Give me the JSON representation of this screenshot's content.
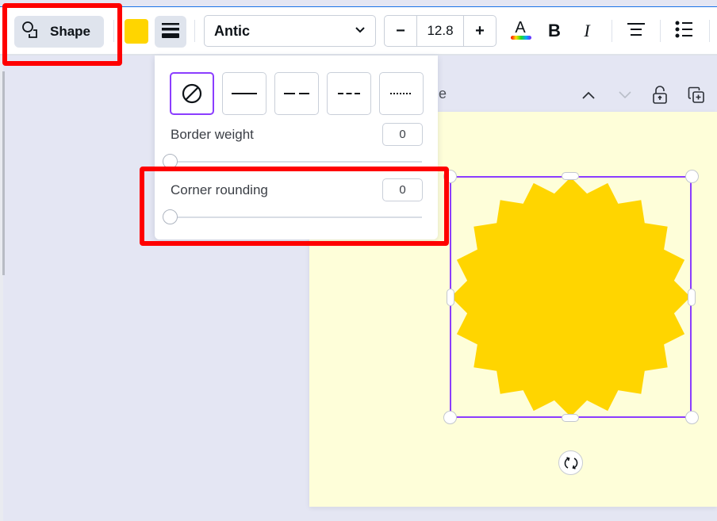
{
  "toolbar": {
    "shape_button_label": "Shape",
    "fill_color": "#ffd500",
    "font_family": "Antic",
    "font_size": "12.8",
    "decrease_label": "−",
    "increase_label": "+",
    "bold_label": "B",
    "italic_label": "I"
  },
  "border_popover": {
    "styles": [
      {
        "name": "none",
        "selected": true
      },
      {
        "name": "solid",
        "selected": false
      },
      {
        "name": "long-dash",
        "selected": false
      },
      {
        "name": "short-dash",
        "selected": false
      },
      {
        "name": "dotted",
        "selected": false
      }
    ],
    "border_weight_label": "Border weight",
    "border_weight_value": "0",
    "border_weight_fraction": 0,
    "corner_rounding_label": "Corner rounding",
    "corner_rounding_value": "0",
    "corner_rounding_fraction": 0
  },
  "page": {
    "title_partial": "itle",
    "background_color": "#fefed9"
  },
  "selection": {
    "shape": "starburst",
    "points": 20,
    "shape_color": "#ffd500",
    "selection_color": "#8b3dff"
  },
  "highlights": {
    "color": "#ff0000"
  }
}
